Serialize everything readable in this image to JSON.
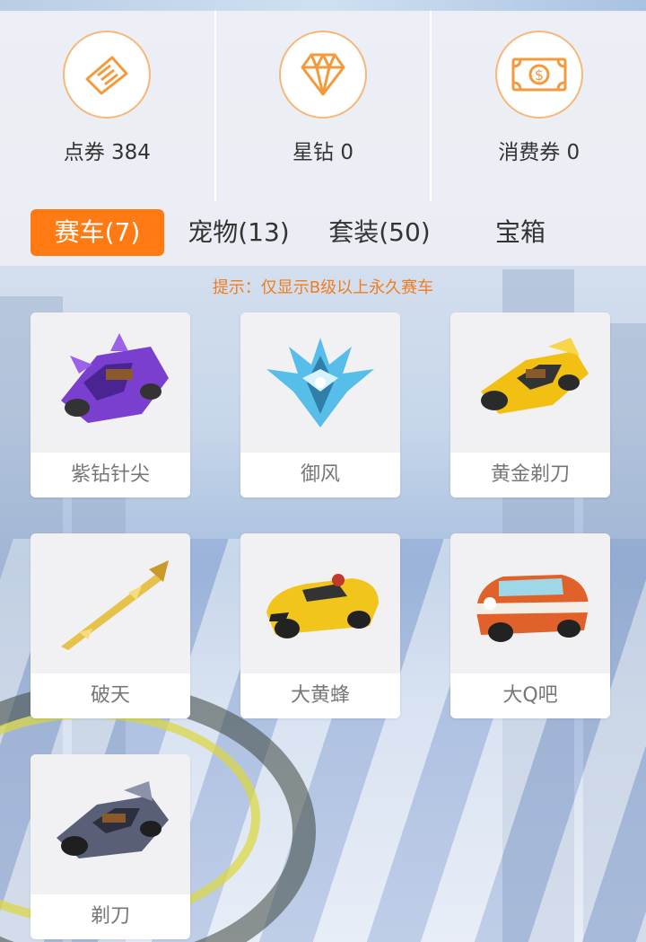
{
  "stats": [
    {
      "label": "点券 384",
      "icon": "ticket-icon"
    },
    {
      "label": "星钻 0",
      "icon": "diamond-icon"
    },
    {
      "label": "消费券 0",
      "icon": "dollar-bill-icon"
    }
  ],
  "tabs": [
    {
      "label": "赛车(7)",
      "active": true
    },
    {
      "label": "宠物(13)",
      "active": false
    },
    {
      "label": "套装(50)",
      "active": false
    },
    {
      "label": "宝箱",
      "active": false
    }
  ],
  "tip": "提示：仅显示B级以上永久赛车",
  "cars": [
    {
      "name": "紫钻针尖",
      "color": "#7b3fd0"
    },
    {
      "name": "御风",
      "color": "#4fb7e6"
    },
    {
      "name": "黄金剃刀",
      "color": "#f2c012"
    },
    {
      "name": "破天",
      "color": "#e6c24a"
    },
    {
      "name": "大黄蜂",
      "color": "#f1c51c"
    },
    {
      "name": "大Q吧",
      "color": "#e0612a"
    },
    {
      "name": "剃刀",
      "color": "#5a5f78"
    }
  ],
  "colors": {
    "accent": "#ff7a12",
    "tip": "#f07d1e",
    "icon_stroke": "#f39a3c"
  }
}
